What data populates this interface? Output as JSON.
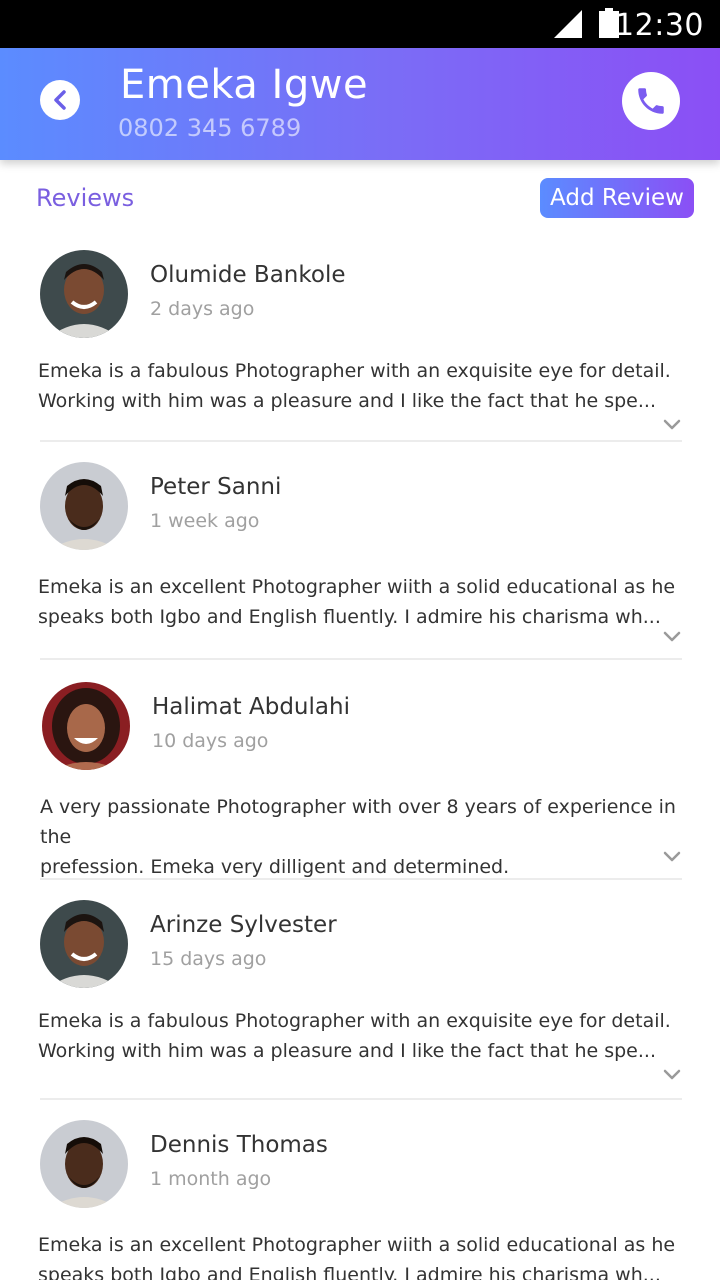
{
  "status_bar": {
    "time": "12:30"
  },
  "header": {
    "title": "Emeka Igwe",
    "subtitle": "0802 345 6789",
    "back_icon": "chevron-left-icon",
    "call_icon": "phone-icon"
  },
  "reviews_section": {
    "label": "Reviews",
    "add_button_label": "Add Review"
  },
  "reviews": [
    {
      "name": "Olumide Bankole",
      "time": "2 days ago",
      "text_line1": "Emeka is a fabulous Photographer with an exquisite eye for detail.",
      "text_line2": "Working with him was a pleasure and I like the fact that he spe..."
    },
    {
      "name": "Peter Sanni",
      "time": "1 week ago",
      "text_line1": "Emeka is an excellent Photographer wiith a solid educational as he",
      "text_line2": "speaks both Igbo and English fluently. I admire his charisma wh..."
    },
    {
      "name": "Halimat Abdulahi",
      "time": "10 days ago",
      "text_line1": "A very passionate Photographer with over 8 years of experience in the",
      "text_line2": "prefession. Emeka very dilligent and determined."
    },
    {
      "name": "Arinze Sylvester",
      "time": "15 days ago",
      "text_line1": "Emeka is a fabulous Photographer with an exquisite eye for detail.",
      "text_line2": "Working with him was a pleasure and I like the fact that he spe..."
    },
    {
      "name": "Dennis Thomas",
      "time": "1 month ago",
      "text_line1": "Emeka is an excellent Photographer wiith a solid educational as he",
      "text_line2": "speaks both Igbo and English fluently. I admire his charisma wh..."
    }
  ],
  "colors": {
    "accent": "#7a5fe0",
    "gradient_start": "#5b8cff",
    "gradient_end": "#8b4ff5"
  }
}
